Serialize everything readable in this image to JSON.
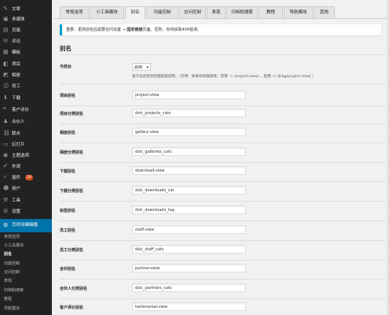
{
  "sidebar": {
    "items": [
      {
        "label": "文章",
        "icon": "pin-icon"
      },
      {
        "label": "多媒体",
        "icon": "media-icon"
      },
      {
        "label": "页面",
        "icon": "page-icon"
      },
      {
        "label": "评论",
        "icon": "comment-icon"
      },
      {
        "label": "模板",
        "icon": "template-icon"
      },
      {
        "label": "项目",
        "icon": "project-icon"
      },
      {
        "label": "相册",
        "icon": "gallery-icon"
      },
      {
        "label": "员工",
        "icon": "staff-icon"
      },
      {
        "label": "下载",
        "icon": "download-icon"
      },
      {
        "label": "客户评价",
        "icon": "quote-icon"
      },
      {
        "label": "合伙人",
        "icon": "partner-icon"
      },
      {
        "label": "联合",
        "icon": "link-icon"
      },
      {
        "label": "幻灯片",
        "icon": "slides-icon"
      },
      {
        "label": "主题选项",
        "icon": "theme-icon"
      },
      {
        "label": "外观",
        "icon": "brush-icon"
      },
      {
        "label": "插件",
        "icon": "plugin-icon",
        "badge": "20"
      },
      {
        "label": "用户",
        "icon": "user-icon"
      },
      {
        "label": "工具",
        "icon": "wrench-icon"
      },
      {
        "label": "设置",
        "icon": "settings-icon"
      }
    ],
    "active": {
      "label": "页时间编辑器",
      "icon": "gear-icon"
    },
    "subitems": [
      "常规选项",
      "小工具模块",
      "别名",
      "功能控制",
      "访问控制",
      "表现",
      "归档和搜索",
      "教程",
      "导航模块"
    ],
    "current_sub": 2
  },
  "tabs": [
    "常规选项",
    "小工具模块",
    "别名",
    "功能控制",
    "访问控制",
    "表现",
    "归档和搜索",
    "教程",
    "导航模块",
    "其他"
  ],
  "active_tab": 2,
  "notice": {
    "prefix": "重要：",
    "text": "更改别名后需要访问设置 → ",
    "bold": "固定链接",
    "suffix": "页面。否则，你将获取404错误。"
  },
  "section_title": "别名",
  "frontend": {
    "label": "与前台",
    "value": "启用",
    "description": "基于前台检测页面链接结构。（示例：如果你的链接将：禁用 -> /project-view/ ，启用 -> /blog/project-view/ ）"
  },
  "fields": [
    {
      "label": "项目别名",
      "value": "project-view"
    },
    {
      "label": "项目分类别名",
      "value": "dslc_projects_cats"
    },
    {
      "label": "相册别名",
      "value": "gallery-view"
    },
    {
      "label": "相册分类别名",
      "value": "dslc_galleries_cats"
    },
    {
      "label": "下载别名",
      "value": "download-view"
    },
    {
      "label": "下载分类别名",
      "value": "dslc_downloads_cat"
    },
    {
      "label": "标签别名",
      "value": "dslc_downloads_tag"
    },
    {
      "label": "员工别名",
      "value": "staff-view"
    },
    {
      "label": "员工分类别名",
      "value": "dslc_staff_cats"
    },
    {
      "label": "合伙别名",
      "value": "partner-view"
    },
    {
      "label": "合伙人分类别名",
      "value": "dslc_partners_cats"
    },
    {
      "label": "客户评价别名",
      "value": "testimonial-view"
    }
  ]
}
